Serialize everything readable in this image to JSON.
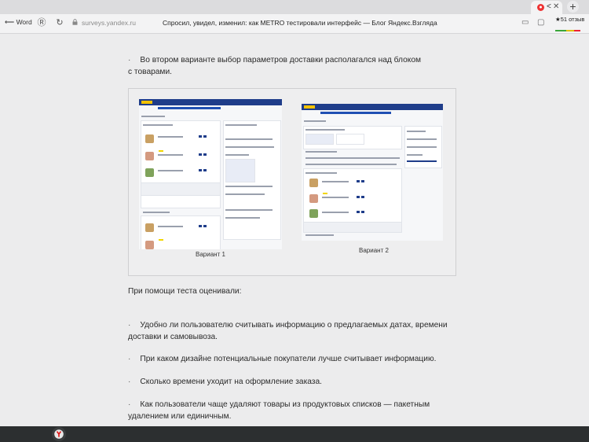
{
  "browser": {
    "tab": {
      "label": "<"
    },
    "nav": {
      "back_label": "Word",
      "domain": "surveys.yandex.ru",
      "page_title": "Спросил, увидел, изменил: как METRO тестировали интерфейс — Блог Яндекс.Взгляда"
    },
    "rating": {
      "text": "★51 отзыв"
    }
  },
  "article": {
    "bullet_symbol": "·",
    "intro_bullet": {
      "line1": "Во втором варианте выбор параметров доставки располагался над блоком",
      "line2": "с товарами."
    },
    "figure": {
      "caption_left": "Вариант 1",
      "caption_right": "Вариант 2"
    },
    "lead": "При помощи теста оценивали:",
    "questions": [
      {
        "line1": "Удобно ли пользователю считывать информацию о предлагаемых датах, времени",
        "line2": "доставки и самовывоза."
      },
      {
        "line1": "При каком дизайне потенциальные покупатели лучше считывает информацию.",
        "line2": ""
      },
      {
        "line1": "Сколько времени уходит на оформление заказа.",
        "line2": ""
      },
      {
        "line1": "Как пользователи чаще удаляют товары из продуктовых списков — пакетным",
        "line2": "удалением или единичным."
      }
    ]
  },
  "colors": {
    "metro_header": "#1f3d8a",
    "metro_logo": "#f2c200",
    "taskbar": "#2c2f30",
    "tab_badge": "#e33333"
  }
}
